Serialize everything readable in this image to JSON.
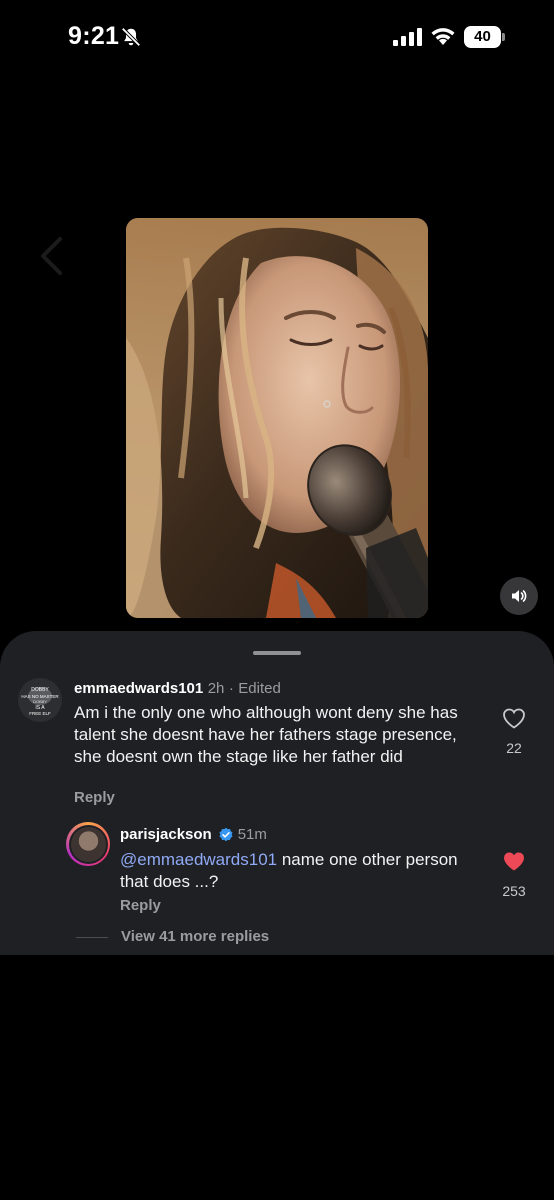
{
  "status_bar": {
    "time": "9:21",
    "battery": "40",
    "icons": [
      "bell-slash-icon",
      "cellular-signal-icon",
      "wifi-icon",
      "battery-icon"
    ]
  },
  "video": {
    "sound_icon": "speaker-icon"
  },
  "comments": [
    {
      "username": "emmaedwards101",
      "age": "2h",
      "separator": "·",
      "edited": "Edited",
      "text": "Am i the only one who although wont deny she has talent she doesnt have her fathers stage presence, she doesnt own the stage like her father did",
      "reply_label": "Reply",
      "like_count": "22",
      "liked": false,
      "avatar_text": [
        "DOBBY",
        "HAS NO MASTER",
        "DOBBY",
        "IS A",
        "FREE ELF"
      ]
    }
  ],
  "reply": {
    "username": "parisjackson",
    "verified": true,
    "age": "51m",
    "mention": "@emmaedwards101",
    "text": " name one other person that does ...?",
    "reply_label": "Reply",
    "like_count": "253",
    "liked": true
  },
  "thread": {
    "view_more": "View 41 more replies"
  },
  "colors": {
    "sheet_bg": "#1e2024",
    "mention": "#90a9f4",
    "liked_heart": "#ed4956",
    "verified_badge": "#3797f0"
  }
}
